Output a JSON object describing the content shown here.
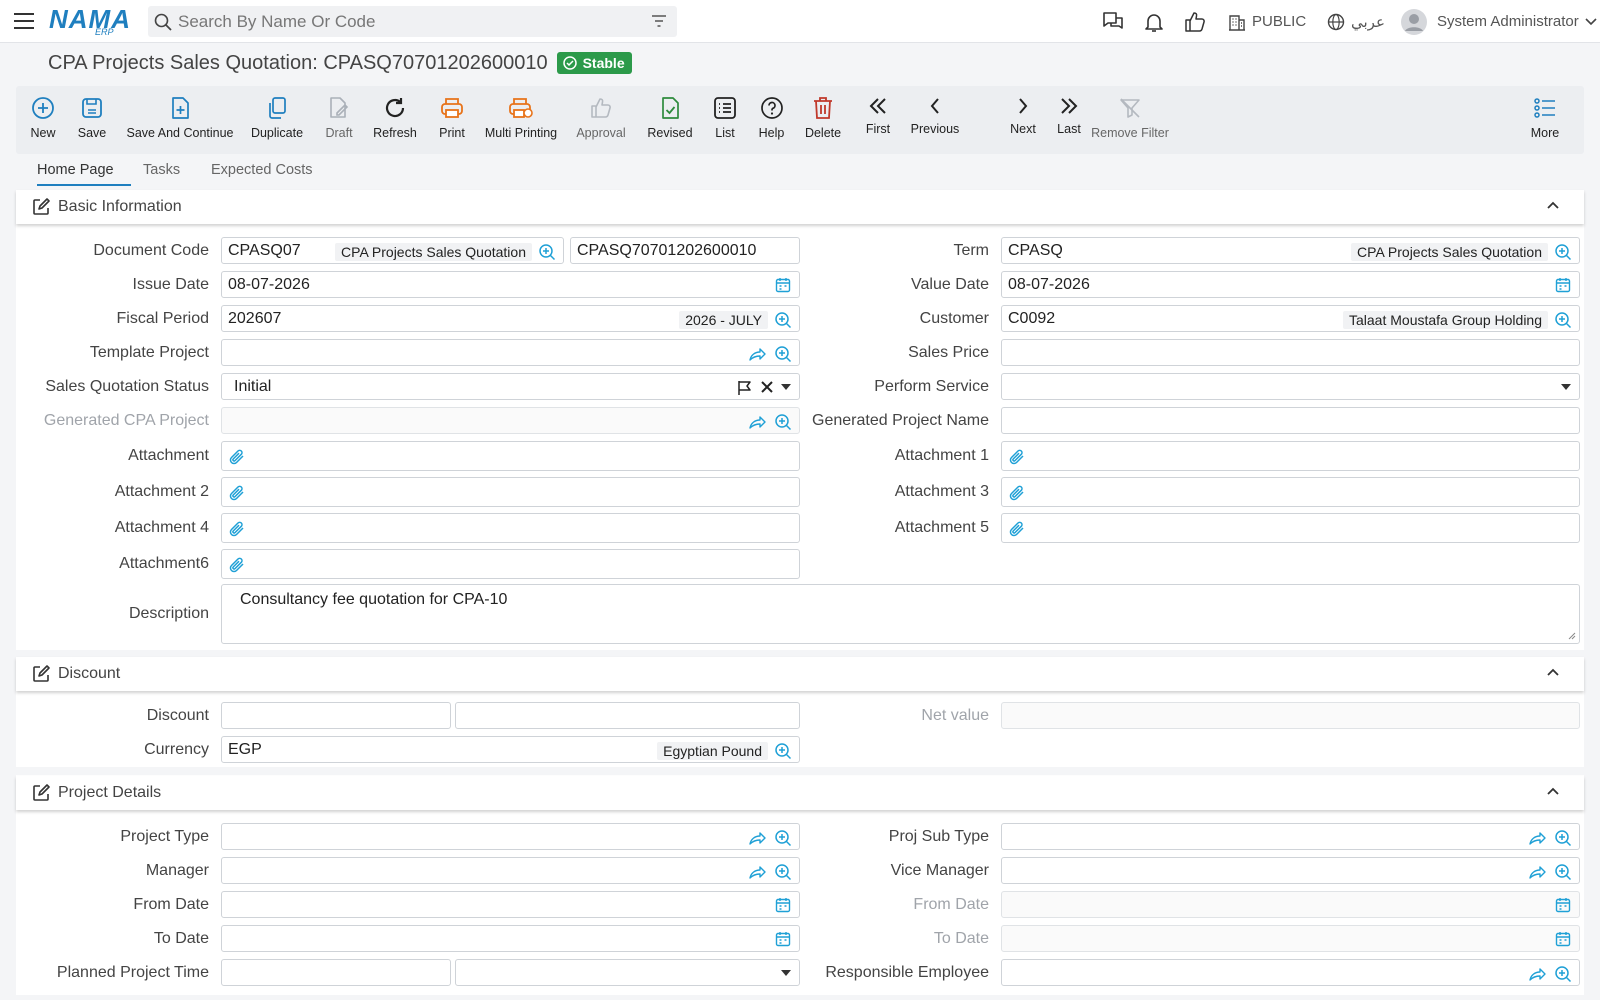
{
  "topbar": {
    "logo_main": "NAMA",
    "logo_sub": "ERP",
    "search_placeholder": "Search By Name Or Code",
    "branch": "PUBLIC",
    "language": "عربي",
    "user": "System Administrator"
  },
  "header": {
    "title": "CPA Projects Sales Quotation: CPASQ70701202600010",
    "status": "Stable"
  },
  "toolbar": {
    "new": "New",
    "save": "Save",
    "save_continue": "Save And Continue",
    "duplicate": "Duplicate",
    "draft": "Draft",
    "refresh": "Refresh",
    "print": "Print",
    "multi_print": "Multi Printing",
    "approval": "Approval",
    "revised": "Revised",
    "list": "List",
    "help": "Help",
    "delete": "Delete",
    "first": "First",
    "previous": "Previous",
    "next": "Next",
    "last": "Last",
    "remove_filter": "Remove Filter",
    "more": "More"
  },
  "tabs": [
    "Home Page",
    "Tasks",
    "Expected Costs"
  ],
  "colors": {
    "accent": "#1f7fbf",
    "stable": "#2c9a4a",
    "delete": "#c0392b",
    "print": "#e8731a",
    "revised": "#2e8b3d"
  },
  "basic": {
    "title": "Basic Information",
    "doc_code_label": "Document Code",
    "doc_code": "CPASQ07",
    "doc_code_desc": "CPA Projects Sales Quotation",
    "doc_number": "CPASQ70701202600010",
    "term_label": "Term",
    "term": "CPASQ",
    "term_desc": "CPA Projects Sales Quotation",
    "issue_date_label": "Issue Date",
    "issue_date": "08-07-2026",
    "value_date_label": "Value Date",
    "value_date": "08-07-2026",
    "fiscal_label": "Fiscal Period",
    "fiscal": "202607",
    "fiscal_desc": "2026 - JULY",
    "customer_label": "Customer",
    "customer": "C0092",
    "customer_desc": "Talaat Moustafa Group Holding",
    "template_label": "Template Project",
    "sales_price_label": "Sales Price",
    "status_label": "Sales Quotation Status",
    "status": "Initial",
    "perform_label": "Perform Service",
    "gen_project_label": "Generated CPA Project",
    "gen_name_label": "Generated Project Name",
    "attachment_label": "Attachment",
    "attachment1_label": "Attachment 1",
    "attachment2_label": "Attachment 2",
    "attachment3_label": "Attachment 3",
    "attachment4_label": "Attachment 4",
    "attachment5_label": "Attachment 5",
    "attachment6_label": "Attachment6",
    "description_label": "Description",
    "description": "Consultancy fee quotation for CPA-10"
  },
  "discount": {
    "title": "Discount",
    "discount_label": "Discount",
    "net_label": "Net value",
    "currency_label": "Currency",
    "currency": "EGP",
    "currency_desc": "Egyptian Pound"
  },
  "project": {
    "title": "Project Details",
    "type_label": "Project Type",
    "subtype_label": "Proj Sub Type",
    "manager_label": "Manager",
    "vice_label": "Vice Manager",
    "from_label": "From Date",
    "from2_label": "From Date",
    "to_label": "To Date",
    "to2_label": "To Date",
    "planned_label": "Planned Project Time",
    "responsible_label": "Responsible Employee"
  }
}
